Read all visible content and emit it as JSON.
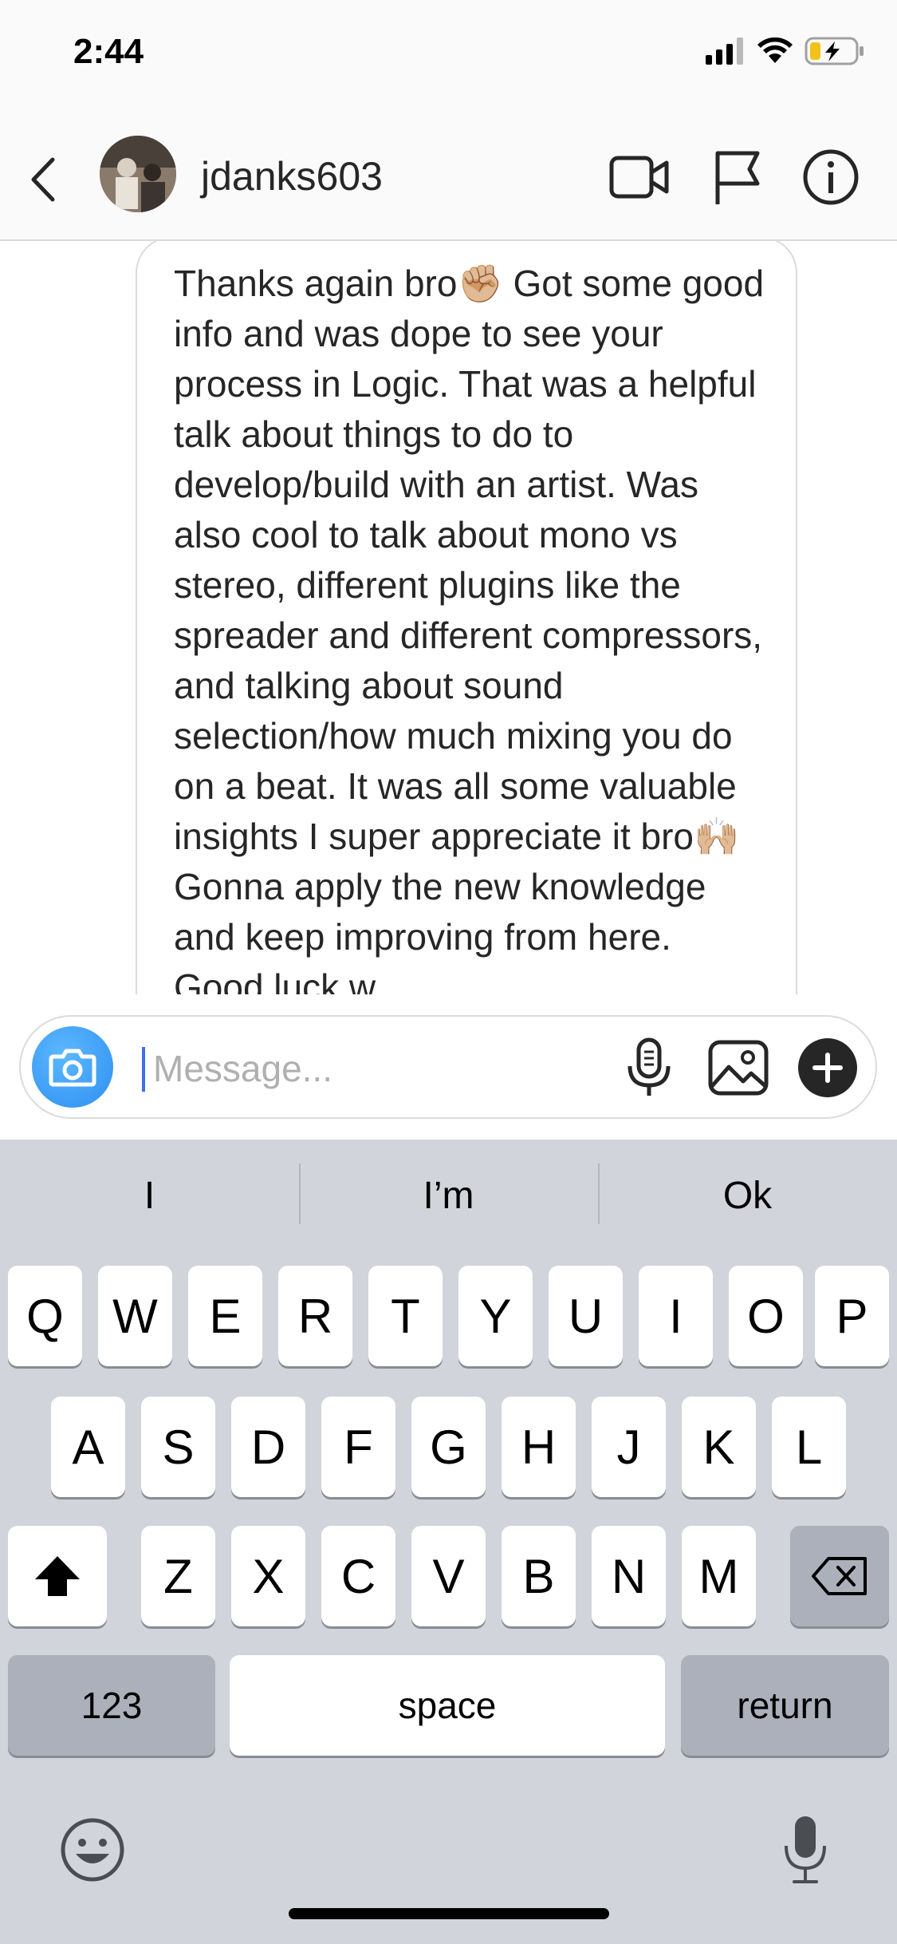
{
  "status_bar": {
    "time": "2:44"
  },
  "header": {
    "username": "jdanks603"
  },
  "message": {
    "text": "Thanks again bro✊🏼 Got some good info and was dope to see your process in Logic. That was a helpful talk about things to do to develop/build with an artist. Was also cool to talk about mono vs stereo, different plugins like the spreader and different compressors, and talking about sound selection/how much mixing you do on a beat. It was all some valuable insights I super appreciate it bro🙌🏼 Gonna apply the new knowledge and keep improving from here. Good luck w"
  },
  "composer": {
    "placeholder": "Message..."
  },
  "keyboard": {
    "suggestions": [
      "I",
      "I’m",
      "Ok"
    ],
    "row1": [
      "Q",
      "W",
      "E",
      "R",
      "T",
      "Y",
      "U",
      "I",
      "O",
      "P"
    ],
    "row2": [
      "A",
      "S",
      "D",
      "F",
      "G",
      "H",
      "J",
      "K",
      "L"
    ],
    "row3": [
      "Z",
      "X",
      "C",
      "V",
      "B",
      "N",
      "M"
    ],
    "numbers_label": "123",
    "space_label": "space",
    "return_label": "return"
  },
  "colors": {
    "accent": "#3897f0",
    "caret": "#3c6fe8",
    "keyboard_bg": "#d1d4da"
  }
}
